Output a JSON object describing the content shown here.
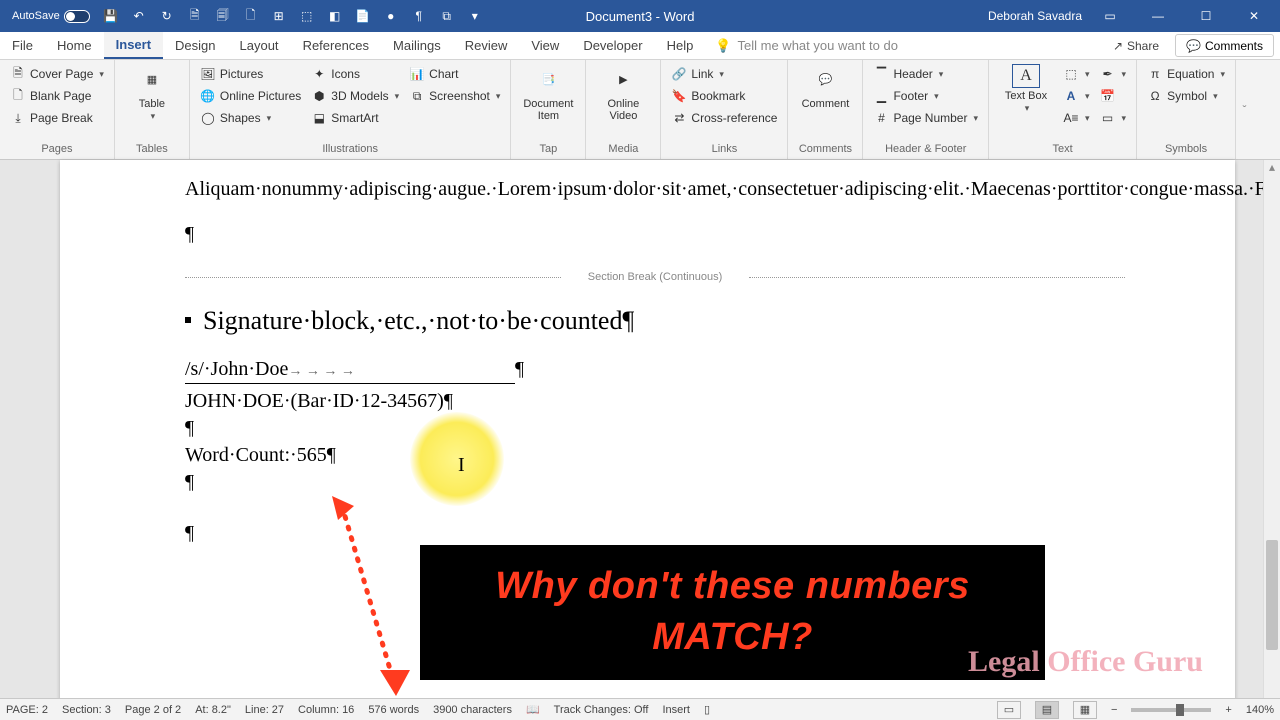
{
  "titlebar": {
    "autosave": "AutoSave",
    "doc_title": "Document3 - Word",
    "user": "Deborah Savadra"
  },
  "tabs": {
    "file": "File",
    "home": "Home",
    "insert": "Insert",
    "design": "Design",
    "layout": "Layout",
    "references": "References",
    "mailings": "Mailings",
    "review": "Review",
    "view": "View",
    "developer": "Developer",
    "help": "Help",
    "tellme": "Tell me what you want to do",
    "share": "Share",
    "comments": "Comments"
  },
  "ribbon": {
    "pages": {
      "cover": "Cover Page",
      "blank": "Blank Page",
      "break": "Page Break",
      "group": "Pages"
    },
    "tables": {
      "table": "Table",
      "group": "Tables"
    },
    "illus": {
      "pictures": "Pictures",
      "online_pics": "Online Pictures",
      "shapes": "Shapes",
      "icons": "Icons",
      "models": "3D Models",
      "smartart": "SmartArt",
      "chart": "Chart",
      "screenshot": "Screenshot",
      "group": "Illustrations"
    },
    "tap": {
      "doc_item": "Document Item",
      "group": "Tap"
    },
    "media": {
      "video": "Online Video",
      "group": "Media"
    },
    "links": {
      "link": "Link",
      "bookmark": "Bookmark",
      "xref": "Cross-reference",
      "group": "Links"
    },
    "comments": {
      "comment": "Comment",
      "group": "Comments"
    },
    "hf": {
      "header": "Header",
      "footer": "Footer",
      "pagenum": "Page Number",
      "group": "Header & Footer"
    },
    "text": {
      "textbox": "Text Box",
      "group": "Text"
    },
    "symbols": {
      "equation": "Equation",
      "symbol": "Symbol",
      "group": "Symbols"
    }
  },
  "doc": {
    "para1": "Aliquam·nonummy·adipiscing·augue.·Lorem·ipsum·dolor·sit·amet,·consectetuer·adipiscing·elit.·Maecenas·porttitor·congue·massa.·Fusce·posuere,·magna·sed·pulvinar·ultricies,·purus·lectus·malesuada·libero,·sit·amet·commodo·magna·eros·quis·urna.·Nunc·viverra·imperdiet·enim.¶",
    "section_break": "Section Break (Continuous)",
    "heading": "Signature·block,·etc.,·not·to·be·counted¶",
    "sig1": "/s/·John·Doe",
    "sig_tabs": "→            →            →            →",
    "sig1_end": "¶",
    "sig2": "JOHN·DOE·(Bar·ID·12-34567)¶",
    "wc": "Word·Count:·565¶",
    "annotation": "Why don't these numbers MATCH?",
    "watermark": "Legal Office Guru"
  },
  "status": {
    "page": "PAGE: 2",
    "section": "Section: 3",
    "pageof": "Page 2 of 2",
    "at": "At: 8.2\"",
    "line": "Line: 27",
    "col": "Column: 16",
    "words": "576 words",
    "chars": "3900 characters",
    "track": "Track Changes: Off",
    "insert": "Insert",
    "zoom": "140%"
  }
}
